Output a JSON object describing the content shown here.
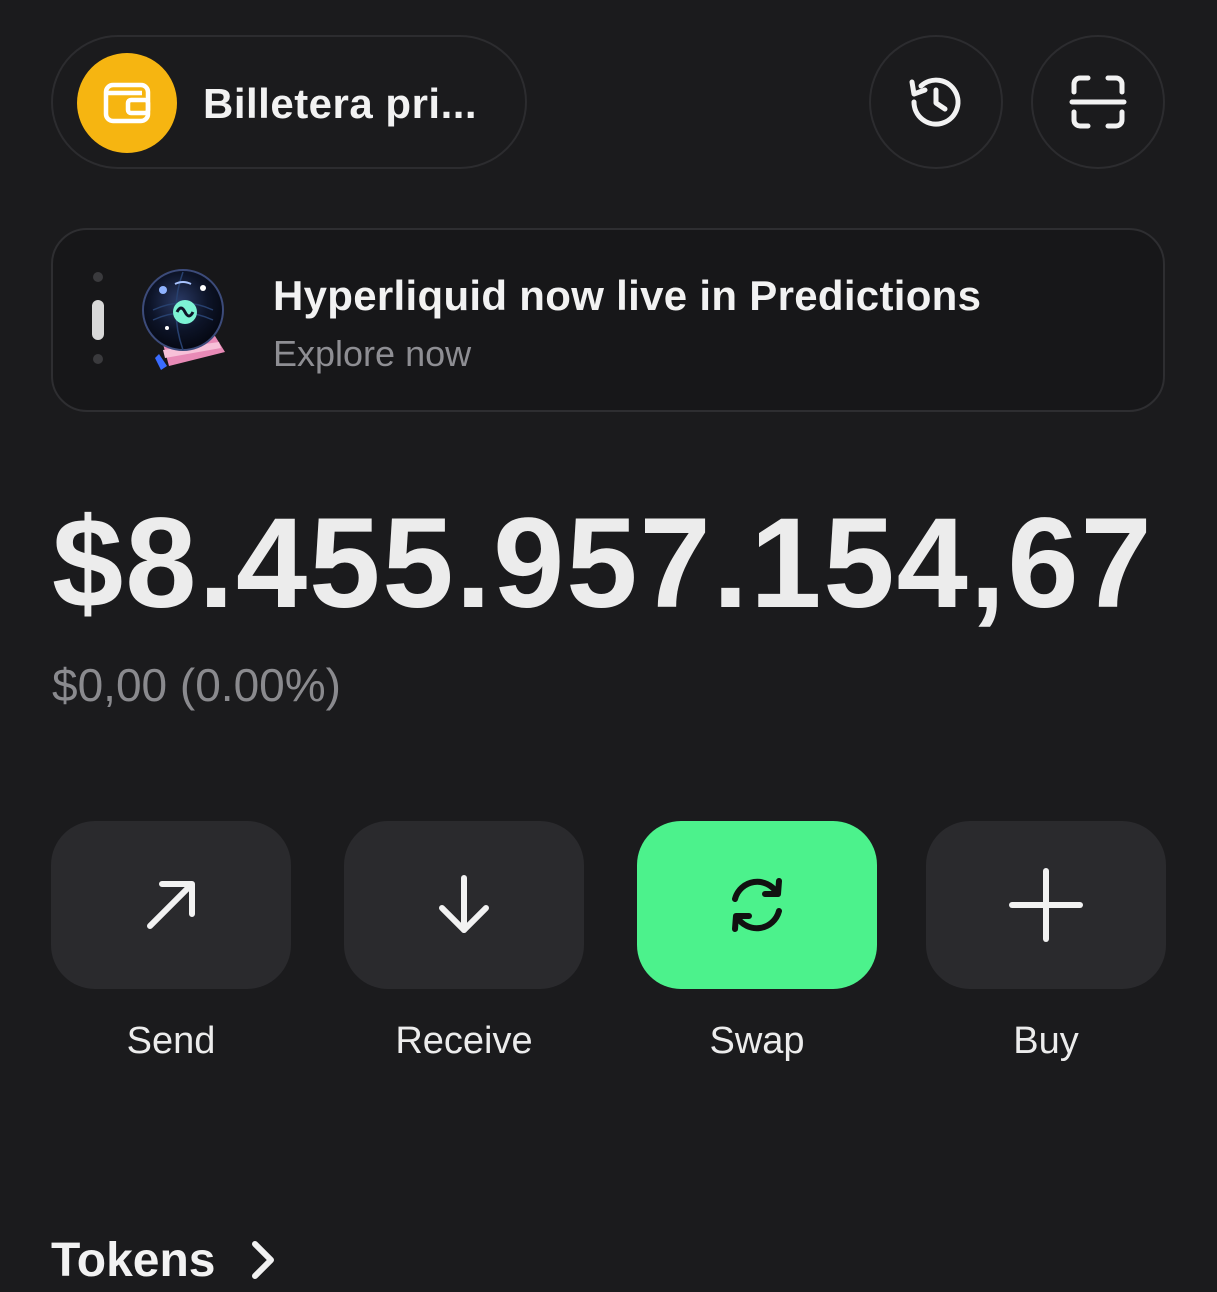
{
  "header": {
    "wallet_name": "Billetera pri...",
    "wallet_color": "#f6b511",
    "history_icon": "history-icon",
    "scan_icon": "scan-icon"
  },
  "banner": {
    "title": "Hyperliquid now live in Predictions",
    "subtitle": "Explore now",
    "art_icon": "crystal-ball-icon"
  },
  "balance": {
    "amount": "$8.455.957.154,67",
    "change": "$0,00 (0.00%)"
  },
  "actions": [
    {
      "label": "Send",
      "icon": "arrow-up-right-icon"
    },
    {
      "label": "Receive",
      "icon": "arrow-down-icon"
    },
    {
      "label": "Swap",
      "icon": "swap-icon",
      "accent": "#4cf28c"
    },
    {
      "label": "Buy",
      "icon": "plus-icon"
    }
  ],
  "sections": {
    "tokens_title": "Tokens",
    "tokens_icon": "chevron-right-icon"
  }
}
